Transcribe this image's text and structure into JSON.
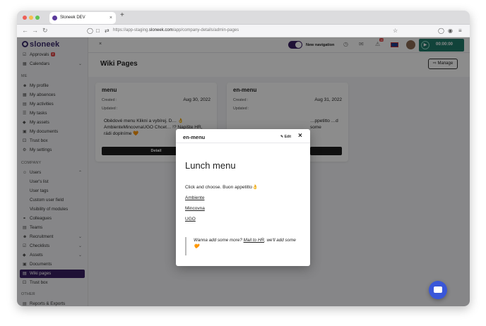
{
  "browser": {
    "tab_title": "Sloneek DEV",
    "tab_close": "×",
    "new_tab": "+",
    "url_prefix": "https://app-staging.",
    "url_domain": "sloneek.com",
    "url_path": "/app/company-details/admin-pages"
  },
  "app": {
    "logo": "sloneek",
    "topbar": {
      "collapse": "×",
      "new_navigation_label": "New navigation",
      "notification_count": "10",
      "timer": "00:00:00"
    },
    "page_title": "Wiki Pages",
    "manage_label": "Manage"
  },
  "sidebar": {
    "items_top": [
      {
        "label": "Approvals",
        "badge": "2"
      },
      {
        "label": "Calendars"
      }
    ],
    "section_me": "ME",
    "me_items": [
      {
        "label": "My profile"
      },
      {
        "label": "My absences"
      },
      {
        "label": "My activities"
      },
      {
        "label": "My tasks"
      },
      {
        "label": "My assets"
      },
      {
        "label": "My documents"
      },
      {
        "label": "Trust box"
      },
      {
        "label": "My settings"
      }
    ],
    "section_company": "COMPANY",
    "company_items": [
      {
        "label": "Users"
      },
      {
        "label": "User's list"
      },
      {
        "label": "User tags"
      },
      {
        "label": "Custom user field"
      },
      {
        "label": "Visibility of modules"
      },
      {
        "label": "Colleagues"
      },
      {
        "label": "Teams"
      },
      {
        "label": "Recruitment"
      },
      {
        "label": "Checklists"
      },
      {
        "label": "Assets"
      },
      {
        "label": "Documents"
      },
      {
        "label": "Wiki pages"
      },
      {
        "label": "Trust box"
      }
    ],
    "section_other": "OTHER",
    "other_items": [
      {
        "label": "Reports & Exports"
      }
    ]
  },
  "cards": [
    {
      "title": "menu",
      "created_label": "Created :",
      "updated_label": "Updated :",
      "date": "Aug 30, 2022",
      "desc": "Obědové menu  Klikni a vybírej. D… 👌AmbienteMincovnaUGO Chcet… !? Napište HR, rádi doplníme 🧡",
      "detail_label": "Detail"
    },
    {
      "title": "en-menu",
      "created_label": "Created :",
      "updated_label": "Updated :",
      "date": "Aug 31, 2022",
      "desc": "…ppetitto …d some"
    }
  ],
  "modal": {
    "title": "en-menu",
    "edit_label": "Edit",
    "close": "×",
    "heading": "Lunch menu",
    "intro": "Click and choose. Buon appetitto👌",
    "links": [
      "Ambiente",
      "Mincovna",
      "UGO"
    ],
    "quote_before": "Wanna add some more? ",
    "quote_link": "Mail to HR",
    "quote_after": ", we'll add some 🧡"
  },
  "colors": {
    "brand": "#3a1f63",
    "timer_bg": "#1f7a6a",
    "chat": "#3a57d8"
  }
}
